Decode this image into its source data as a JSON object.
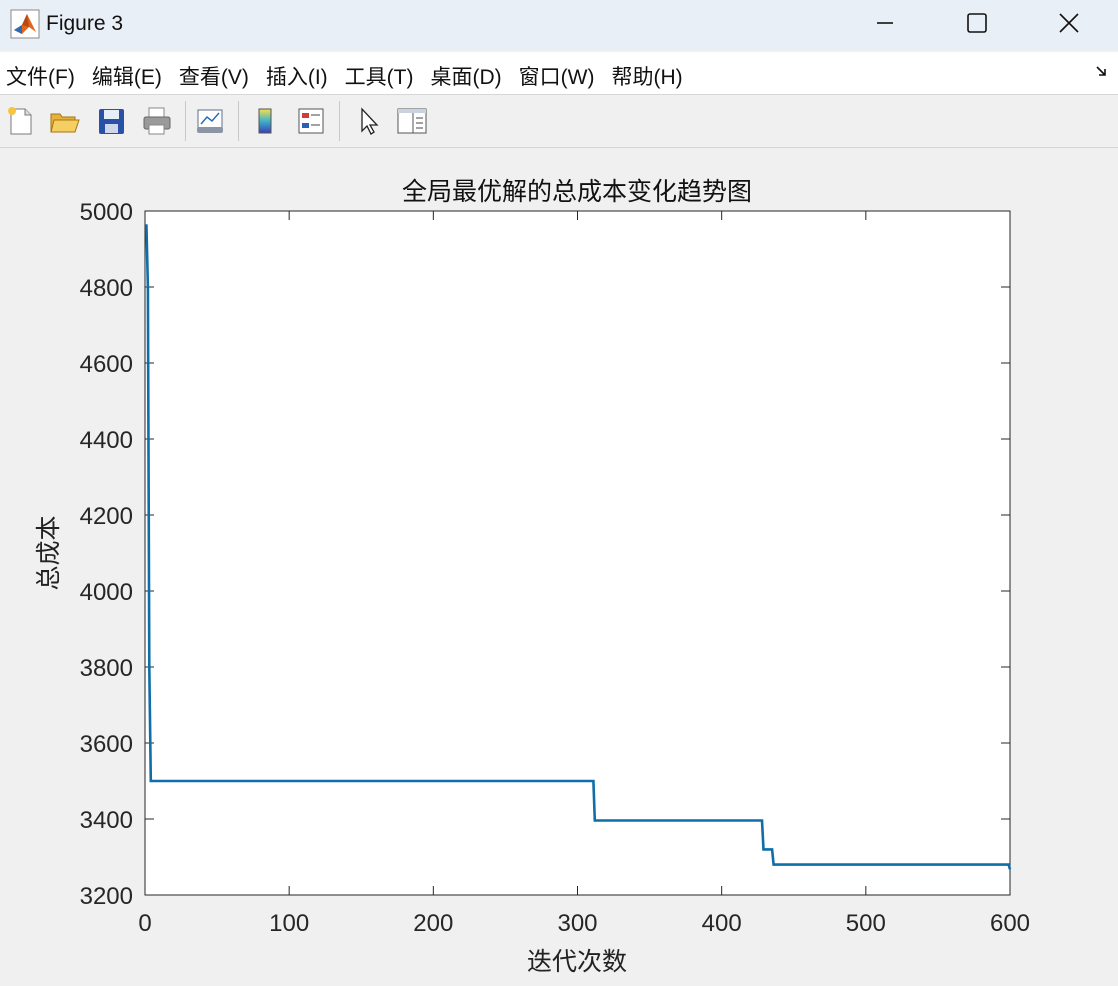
{
  "window": {
    "title": "Figure 3"
  },
  "menu": [
    "文件(F)",
    "编辑(E)",
    "查看(V)",
    "插入(I)",
    "工具(T)",
    "桌面(D)",
    "窗口(W)",
    "帮助(H)"
  ],
  "toolbar": [
    {
      "name": "new-figure-button",
      "icon": "new-document-icon"
    },
    {
      "name": "open-file-button",
      "icon": "folder-open-icon"
    },
    {
      "name": "save-button",
      "icon": "floppy-disk-icon"
    },
    {
      "name": "print-button",
      "icon": "printer-icon"
    },
    {
      "name": "link-plot-button",
      "icon": "linked-plot-icon"
    },
    {
      "name": "insert-colorbar-button",
      "icon": "colorbar-icon"
    },
    {
      "name": "insert-legend-button",
      "icon": "legend-icon"
    },
    {
      "name": "edit-plot-button",
      "icon": "cursor-arrow-icon"
    },
    {
      "name": "property-inspector-button",
      "icon": "panel-icon"
    }
  ],
  "colors": {
    "line": "#0f6ea8",
    "axes_bg": "#ffffff",
    "figure_bg": "#f0f0f0",
    "titlebar_bg": "#e9eff7"
  },
  "chart_data": {
    "type": "line",
    "title": "全局最优解的总成本变化趋势图",
    "xlabel": "迭代次数",
    "ylabel": "总成本",
    "xlim": [
      0,
      600
    ],
    "ylim": [
      3200,
      5000
    ],
    "xticks": [
      0,
      100,
      200,
      300,
      400,
      500,
      600
    ],
    "yticks": [
      3200,
      3400,
      3600,
      3800,
      4000,
      4200,
      4400,
      4600,
      4800,
      5000
    ],
    "grid": false,
    "series": [
      {
        "x": [
          1,
          2,
          3,
          4,
          311,
          312,
          428,
          429,
          435,
          436,
          599,
          600
        ],
        "y": [
          4965,
          4800,
          3800,
          3500,
          3500,
          3396,
          3396,
          3320,
          3320,
          3280,
          3280,
          3268
        ]
      }
    ]
  }
}
